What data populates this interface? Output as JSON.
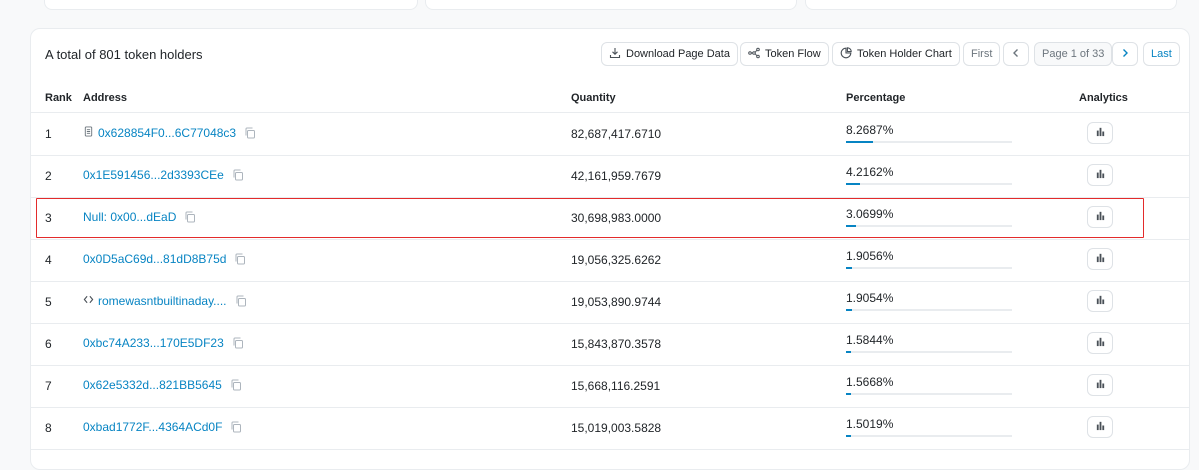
{
  "header": {
    "total_text": "A total of 801 token holders",
    "download_label": "Download Page Data",
    "token_flow_label": "Token Flow",
    "holder_chart_label": "Token Holder Chart",
    "first_label": "First",
    "page_label": "Page 1 of 33",
    "last_label": "Last"
  },
  "columns": {
    "rank": "Rank",
    "address": "Address",
    "quantity": "Quantity",
    "percentage": "Percentage",
    "analytics": "Analytics"
  },
  "rows": [
    {
      "rank": "1",
      "address": "0x628854F0...6C77048c3",
      "icon": "document-icon",
      "quantity": "82,687,417.6710",
      "percentage": "8.2687%",
      "pct": 8.2687
    },
    {
      "rank": "2",
      "address": "0x1E591456...2d3393CEe",
      "icon": "",
      "quantity": "42,161,959.7679",
      "percentage": "4.2162%",
      "pct": 4.2162
    },
    {
      "rank": "3",
      "address": "Null: 0x00...dEaD",
      "icon": "",
      "quantity": "30,698,983.0000",
      "percentage": "3.0699%",
      "pct": 3.0699
    },
    {
      "rank": "4",
      "address": "0x0D5aC69d...81dD8B75d",
      "icon": "",
      "quantity": "19,056,325.6262",
      "percentage": "1.9056%",
      "pct": 1.9056
    },
    {
      "rank": "5",
      "address": "romewasntbuiltinaday....",
      "icon": "code-icon",
      "quantity": "19,053,890.9744",
      "percentage": "1.9054%",
      "pct": 1.9054
    },
    {
      "rank": "6",
      "address": "0xbc74A233...170E5DF23",
      "icon": "",
      "quantity": "15,843,870.3578",
      "percentage": "1.5844%",
      "pct": 1.5844
    },
    {
      "rank": "7",
      "address": "0x62e5332d...821BB5645",
      "icon": "",
      "quantity": "15,668,116.2591",
      "percentage": "1.5668%",
      "pct": 1.5668
    },
    {
      "rank": "8",
      "address": "0xbad1772F...4364ACd0F",
      "icon": "",
      "quantity": "15,019,003.5828",
      "percentage": "1.5019%",
      "pct": 1.5019
    }
  ],
  "colors": {
    "link": "#0784c3",
    "highlight": "#e32b2b"
  }
}
